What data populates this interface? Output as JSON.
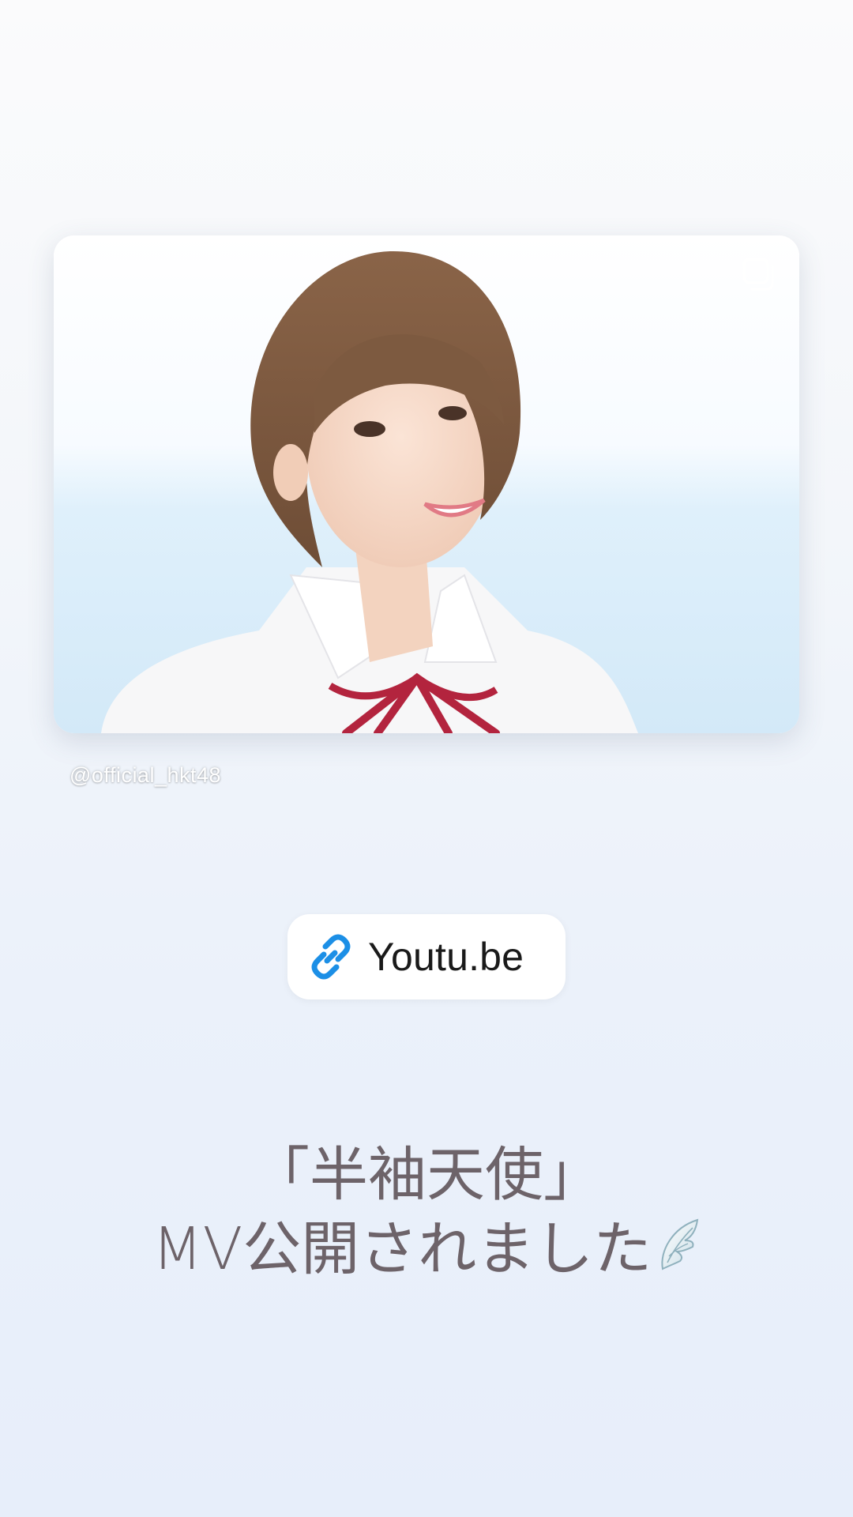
{
  "post": {
    "username": "@official_hkt48",
    "multi_icon": "multiple-photos-icon"
  },
  "link_sticker": {
    "icon": "link-icon",
    "label": "Youtu.be",
    "icon_color": "#1c8fe6"
  },
  "caption": {
    "line1": "「半袖天使」",
    "line2": "MV公開されました",
    "emoji": "wing-icon"
  },
  "colors": {
    "background_top": "#fbfbfc",
    "background_bottom": "#e7eefa",
    "caption_text": "#6d6369"
  }
}
